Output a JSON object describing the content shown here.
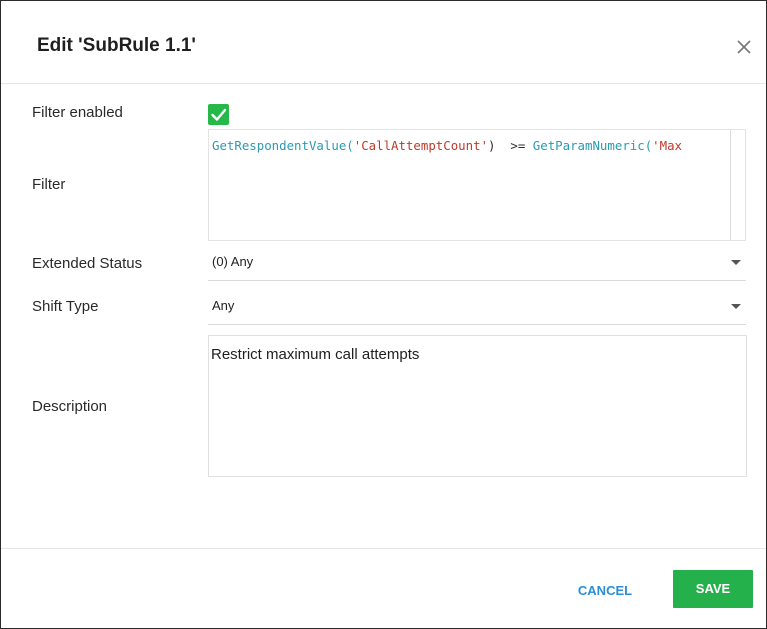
{
  "dialog": {
    "title": "Edit 'SubRule 1.1'",
    "close_icon": "close-icon"
  },
  "form": {
    "filter_enabled": {
      "label": "Filter enabled",
      "checked": true,
      "color": "#27b84a"
    },
    "filter": {
      "label": "Filter",
      "code_fn1": "GetRespondentValue(",
      "code_arg1": "'CallAttemptCount'",
      "code_mid": ")  >= ",
      "code_fn2": "GetParamNumeric(",
      "code_arg2": "'Max"
    },
    "extended_status": {
      "label": "Extended Status",
      "value": "(0) Any"
    },
    "shift_type": {
      "label": "Shift Type",
      "value": "Any"
    },
    "description": {
      "label": "Description",
      "value": "Restrict maximum call attempts"
    }
  },
  "footer": {
    "cancel_label": "CANCEL",
    "save_label": "SAVE",
    "cancel_color": "#2c8fd6",
    "save_color": "#24b04a"
  }
}
